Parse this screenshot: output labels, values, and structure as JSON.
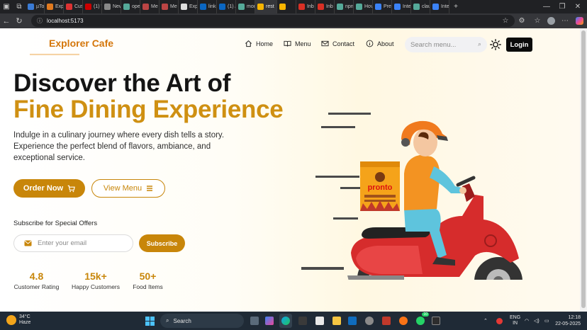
{
  "browser": {
    "tabs": [
      {
        "label": "µTo",
        "color": "#3a7bd5"
      },
      {
        "label": "Exp",
        "color": "#e07a1f"
      },
      {
        "label": "Cus",
        "color": "#d33"
      },
      {
        "label": "(1) \"",
        "color": "#c00"
      },
      {
        "label": "New",
        "color": "#888"
      },
      {
        "label": "ope",
        "color": "#5a9"
      },
      {
        "label": "Me",
        "color": "#b44"
      },
      {
        "label": "Me",
        "color": "#b44"
      },
      {
        "label": "Exp",
        "color": "#ddd"
      },
      {
        "label": "link",
        "color": "#0a66c2"
      },
      {
        "label": "(1) /",
        "color": "#0a66c2"
      },
      {
        "label": "mor",
        "color": "#5a9"
      },
      {
        "label": "rest",
        "color": "#f7b500"
      },
      {
        "label": "",
        "color": "#f7b500"
      },
      {
        "label": "Inb",
        "color": "#d93025"
      },
      {
        "label": "Inb",
        "color": "#d93025"
      },
      {
        "label": "npn",
        "color": "#5a9"
      },
      {
        "label": "Hov",
        "color": "#5a9"
      },
      {
        "label": "Pre",
        "color": "#3b82f6"
      },
      {
        "label": "Inte",
        "color": "#3b82f6"
      },
      {
        "label": "clau",
        "color": "#5a9"
      },
      {
        "label": "Inte",
        "color": "#3b82f6"
      }
    ],
    "url": "localhost:5173"
  },
  "header": {
    "logo": "Explorer Cafe",
    "nav": {
      "home": "Home",
      "menu": "Menu",
      "contact": "Contact",
      "about": "About"
    },
    "search_placeholder": "Search menu...",
    "login": "Login"
  },
  "hero": {
    "title_line1": "Discover the Art of",
    "title_line2": "Fine Dining Experience",
    "description": "Indulge in a culinary journey where every dish tells a story. Experience the perfect blend of flavors, ambiance, and exceptional service.",
    "order_now": "Order Now",
    "view_menu": "View Menu",
    "subscribe_label": "Subscribe for Special Offers",
    "email_placeholder": "Enter your email",
    "subscribe_button": "Subscribe",
    "stats": [
      {
        "value": "4.8",
        "label": "Customer Rating"
      },
      {
        "value": "15k+",
        "label": "Happy Customers"
      },
      {
        "value": "50+",
        "label": "Food Items"
      }
    ],
    "illustration": {
      "box_brand": "pronto"
    }
  },
  "taskbar": {
    "weather_temp": "34°C",
    "weather_cond": "Haze",
    "search": "Search",
    "lang1": "ENG",
    "lang2": "IN",
    "time": "12:18",
    "date": "22-05-2025",
    "badge": "10"
  },
  "colors": {
    "accent": "#c8860a",
    "logo": "#d4760b",
    "heading": "#141414"
  }
}
